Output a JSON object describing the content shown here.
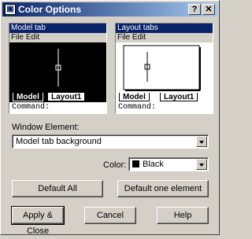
{
  "window": {
    "title": "Color Options"
  },
  "titlebar": {
    "help_label": "?",
    "close_label": "✕",
    "app_icon": "app-icon"
  },
  "preview_model": {
    "title": "Model tab",
    "menu": "File  Edit",
    "tabs": [
      "Model",
      "Layout1"
    ],
    "command": "Command:",
    "colors": {
      "background": "#000000",
      "crosshair": "#ffffff"
    }
  },
  "preview_layout": {
    "title": "Layout tabs",
    "menu": "File  Edit",
    "tabs": [
      "Model",
      "Layout1"
    ],
    "command": "Command:",
    "colors": {
      "background": "#ffffff",
      "crosshair": "#000000"
    }
  },
  "window_element": {
    "label": "Window Element:",
    "value": "Model tab background"
  },
  "color": {
    "label": "Color:",
    "value": "Black",
    "swatch": "#000000"
  },
  "buttons": {
    "default_all": "Default All",
    "default_one": "Default one element",
    "apply_close": "Apply & Close",
    "cancel": "Cancel",
    "help": "Help"
  }
}
